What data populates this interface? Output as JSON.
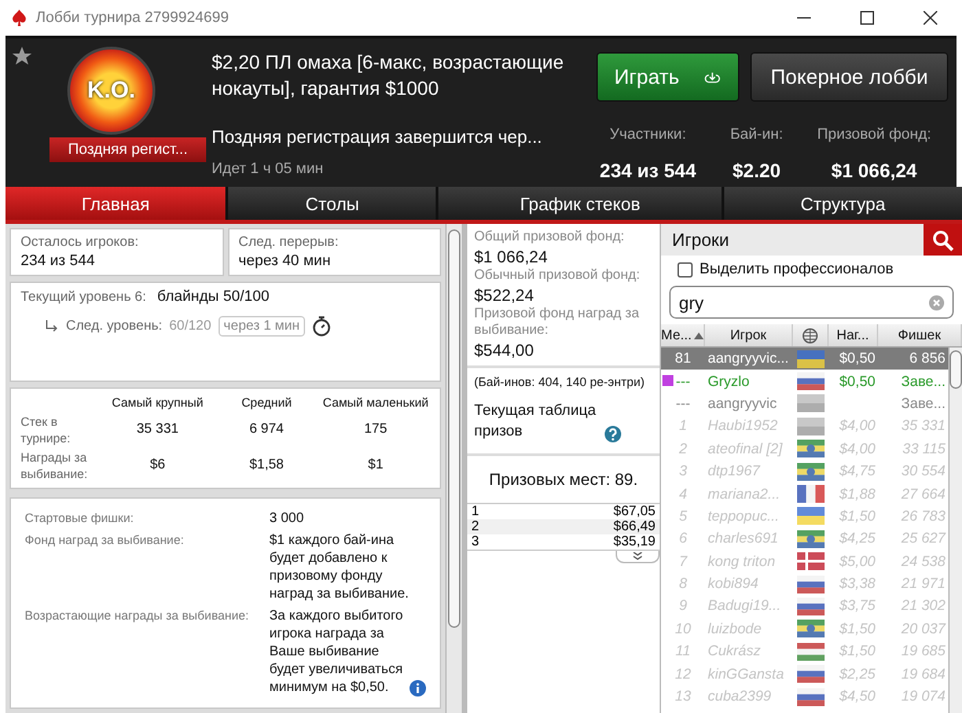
{
  "window": {
    "title": "Лобби турнира 2799924699"
  },
  "header": {
    "badge": "K.O.",
    "ribbon": "Поздняя регист...",
    "title": "$2,20 ПЛ омаха [6-макс, возрастающие нокауты], гарантия $1000",
    "late_reg": "Поздняя регистрация завершится чер...",
    "running": "Идет 1 ч 05 мин",
    "stats": [
      {
        "label": "Участники:",
        "value": "234 из 544"
      },
      {
        "label": "Бай-ин:",
        "value": "$2.20"
      },
      {
        "label": "Призовой фонд:",
        "value": "$1 066,24"
      }
    ],
    "buttons": [
      {
        "label": "Играть",
        "kind": "primary"
      },
      {
        "label": "Покерное лобби",
        "kind": "secondary"
      }
    ]
  },
  "tabs": [
    {
      "label": "Главная",
      "selected": true
    },
    {
      "label": "Столы",
      "selected": false
    },
    {
      "label": "График стеков",
      "selected": false
    },
    {
      "label": "Структура",
      "selected": false
    }
  ],
  "summary": {
    "players_left": {
      "label": "Осталось игроков:",
      "value": "234 из 544"
    },
    "next_break": {
      "label": "След. перерыв:",
      "value": "через 40 мин"
    },
    "level": {
      "label": "Текущий уровень 6:",
      "value": "блайнды 50/100",
      "next_label": "След. уровень:",
      "next_value": "60/120",
      "next_time": "через 1 мин"
    },
    "stacks": {
      "columns": [
        "Самый крупный",
        "Средний",
        "Самый маленький"
      ],
      "rows": [
        {
          "label": "Стек в турнире:",
          "values": [
            "35 331",
            "6 974",
            "175"
          ]
        },
        {
          "label": "Награды за выбивание:",
          "values": [
            "$6",
            "$1,58",
            "$1"
          ]
        }
      ]
    },
    "details": [
      {
        "label": "Стартовые фишки:",
        "value": "3 000"
      },
      {
        "label": "Фонд наград за выбивание:",
        "value": "$1 каждого бай-ина будет добавлено к призовому фонду наград за выбивание."
      },
      {
        "label": "Возрастающие награды за выбивание:",
        "value": "За каждого выбитого игрока награда за Ваше выбивание будет увеличиваться минимум на $0,50.",
        "info": true
      }
    ]
  },
  "prizes": {
    "pools": [
      {
        "label": "Общий призовой фонд:",
        "value": "$1 066,24"
      },
      {
        "label": "Обычный призовой фонд:",
        "value": "$522,24"
      },
      {
        "label": "Призовой фонд наград за выбивание:",
        "value": "$544,00"
      }
    ],
    "buyins": "(Бай-инов: 404, 140 ре-энтри)",
    "table_title": "Текущая таблица призов",
    "places": "Призовых мест: 89.",
    "payouts": [
      {
        "place": "1",
        "amount": "$67,05"
      },
      {
        "place": "2",
        "amount": "$66,49"
      },
      {
        "place": "3",
        "amount": "$35,19"
      }
    ]
  },
  "players": {
    "title": "Игроки",
    "highlight_pros": {
      "label": "Выделить профессионалов",
      "checked": false
    },
    "search": {
      "value": "gry"
    },
    "columns": [
      "Ме...",
      "Игрок",
      "Наг...",
      "Фишек"
    ],
    "rows": [
      {
        "kind": "plain",
        "selected": true,
        "rank": "81",
        "name": "aangryyvic...",
        "flag": {
          "kind": "ua"
        },
        "bounty": "$0,50",
        "chips": "6 856"
      },
      {
        "kind": "match",
        "selected": false,
        "color": "#c040e0",
        "rank": "---",
        "name": "Gryzlo",
        "flag": {
          "kind": "ru"
        },
        "bounty": "$0,50",
        "chips": "Заве..."
      },
      {
        "kind": "plain",
        "selected": false,
        "rank": "---",
        "name": "aangryyvic",
        "flag": {
          "kind": "gray"
        },
        "chips": "Заве..."
      },
      {
        "kind": "faded",
        "selected": false,
        "rank": "1",
        "name": "Haubi1952",
        "flag": {
          "kind": "gray"
        },
        "bounty": "$4,00",
        "chips": "35 331"
      },
      {
        "kind": "faded",
        "selected": false,
        "rank": "2",
        "name": "ateofinal [2]",
        "flag": {
          "kind": "br"
        },
        "bounty": "$4,00",
        "chips": "33 115"
      },
      {
        "kind": "faded",
        "selected": false,
        "rank": "3",
        "name": "dtp1967",
        "flag": {
          "kind": "br"
        },
        "bounty": "$4,75",
        "chips": "30 554"
      },
      {
        "kind": "faded",
        "selected": false,
        "rank": "4",
        "name": "mariana2...",
        "flag": {
          "kind": "fr"
        },
        "bounty": "$1,88",
        "chips": "27 664"
      },
      {
        "kind": "faded",
        "selected": false,
        "rank": "5",
        "name": "teppopuc...",
        "flag": {
          "kind": "ua"
        },
        "bounty": "$1,50",
        "chips": "26 783"
      },
      {
        "kind": "faded",
        "selected": false,
        "rank": "6",
        "name": "charles691",
        "flag": {
          "kind": "br"
        },
        "bounty": "$4,25",
        "chips": "25 627"
      },
      {
        "kind": "faded",
        "selected": false,
        "rank": "7",
        "name": "kong triton",
        "flag": {
          "kind": "dk"
        },
        "bounty": "$5,00",
        "chips": "24 538"
      },
      {
        "kind": "faded",
        "selected": false,
        "rank": "8",
        "name": "kobi894",
        "flag": {
          "kind": "ru"
        },
        "bounty": "$3,38",
        "chips": "21 971"
      },
      {
        "kind": "faded",
        "selected": false,
        "rank": "9",
        "name": "Badugi19...",
        "flag": {
          "kind": "ru"
        },
        "bounty": "$3,75",
        "chips": "21 302"
      },
      {
        "kind": "faded",
        "selected": false,
        "rank": "10",
        "name": "luizbode",
        "flag": {
          "kind": "br"
        },
        "bounty": "$1,50",
        "chips": "20 037"
      },
      {
        "kind": "faded",
        "selected": false,
        "rank": "11",
        "name": "Cukrász",
        "flag": {
          "kind": "hu"
        },
        "bounty": "$1,50",
        "chips": "19 685"
      },
      {
        "kind": "faded",
        "selected": false,
        "rank": "12",
        "name": "kinGGansta",
        "flag": {
          "kind": "ru"
        },
        "bounty": "$2,25",
        "chips": "19 684"
      },
      {
        "kind": "faded",
        "selected": false,
        "rank": "13",
        "name": "cuba2399",
        "flag": {
          "kind": "ru"
        },
        "bounty": "$4,50",
        "chips": "19 074"
      }
    ]
  }
}
